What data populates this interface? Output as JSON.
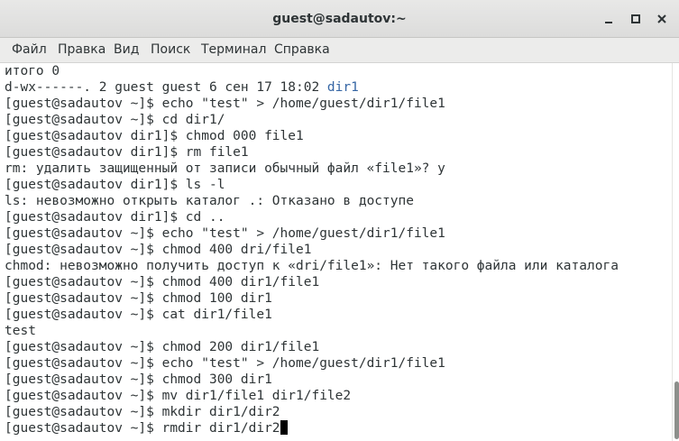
{
  "window": {
    "title": "guest@sadautov:~"
  },
  "menu": {
    "items": [
      "Файл",
      "Правка",
      "Вид",
      "Поиск",
      "Терминал",
      "Справка"
    ]
  },
  "icons": {
    "minimize": "minimize-icon",
    "maximize": "maximize-icon",
    "close": "close-icon"
  },
  "colors": {
    "directory": "#3465a4",
    "text": "#2e3436",
    "background": "#ffffff"
  },
  "terminal": {
    "lines": [
      "итого 0",
      "d-wx------. 2 guest guest 6 сен 17 18:02 ",
      "[guest@sadautov ~]$ echo \"test\" > /home/guest/dir1/file1",
      "[guest@sadautov ~]$ cd dir1/",
      "[guest@sadautov dir1]$ chmod 000 file1",
      "[guest@sadautov dir1]$ rm file1",
      "rm: удалить защищенный от записи обычный файл «file1»? y",
      "[guest@sadautov dir1]$ ls -l",
      "ls: невозможно открыть каталог .: Отказано в доступе",
      "[guest@sadautov dir1]$ cd ..",
      "[guest@sadautov ~]$ echo \"test\" > /home/guest/dir1/file1",
      "[guest@sadautov ~]$ chmod 400 dri/file1",
      "chmod: невозможно получить доступ к «dri/file1»: Нет такого файла или каталога",
      "[guest@sadautov ~]$ chmod 400 dir1/file1",
      "[guest@sadautov ~]$ chmod 100 dir1",
      "[guest@sadautov ~]$ cat dir1/file1",
      "test",
      "[guest@sadautov ~]$ chmod 200 dir1/file1",
      "[guest@sadautov ~]$ echo \"test\" > /home/guest/dir1/file1",
      "[guest@sadautov ~]$ chmod 300 dir1",
      "[guest@sadautov ~]$ mv dir1/file1 dir1/file2",
      "[guest@sadautov ~]$ mkdir dir1/dir2",
      "[guest@sadautov ~]$ rmdir dir1/dir2"
    ],
    "dir_highlight": "dir1"
  }
}
